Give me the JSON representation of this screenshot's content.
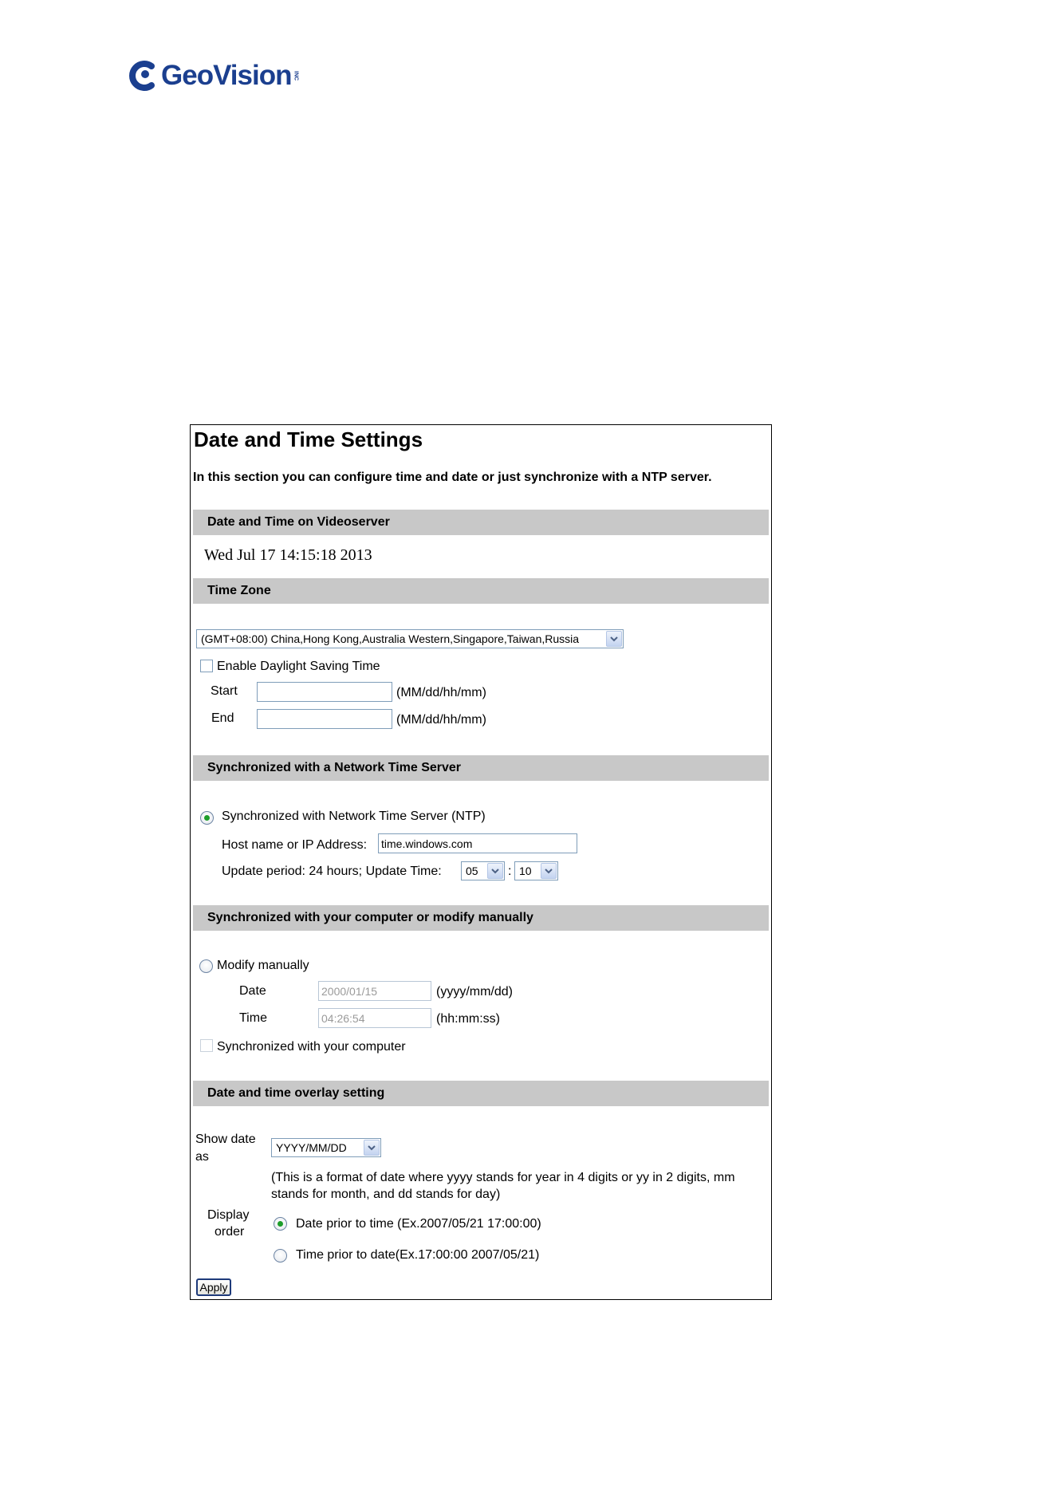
{
  "brand": {
    "name": "GeoVision",
    "inc": "INC"
  },
  "page": {
    "title": "Date and Time Settings",
    "intro": "In this section you can configure time and date or just synchronize with a NTP server."
  },
  "sections": {
    "current": "Date and Time on Videoserver",
    "timezone": "Time Zone",
    "ntp": "Synchronized with a Network Time Server",
    "manual": "Synchronized with your computer or modify manually",
    "overlay": "Date and time overlay setting"
  },
  "current_time": "Wed Jul 17 14:15:18 2013",
  "timezone": {
    "selected": "(GMT+08:00) China,Hong Kong,Australia Western,Singapore,Taiwan,Russia",
    "dst_label": "Enable Daylight Saving Time",
    "dst_checked": false,
    "start_label": "Start",
    "end_label": "End",
    "start_value": "",
    "end_value": "",
    "format_hint": "(MM/dd/hh/mm)"
  },
  "ntp": {
    "radio_label": "Synchronized with Network Time Server (NTP)",
    "selected": true,
    "host_label": "Host name or IP Address:",
    "host_value": "time.windows.com",
    "update_label": "Update period: 24 hours; Update Time:",
    "hour": "05",
    "separator": ":",
    "minute": "10"
  },
  "manual": {
    "radio_label": "Modify manually",
    "date_label": "Date",
    "date_value": "2000/01/15",
    "date_hint": "(yyyy/mm/dd)",
    "time_label": "Time",
    "time_value": "04:26:54",
    "time_hint": "(hh:mm:ss)",
    "sync_label": "Synchronized with your computer"
  },
  "overlay": {
    "show_date_label_1": "Show date",
    "show_date_label_2": "as",
    "date_format": "YYYY/MM/DD",
    "format_note_1": "(This is a format of date where yyyy stands for year in 4 digits or yy in 2 digits, mm",
    "format_note_2": "stands for month, and dd stands for day)",
    "display_order_label_1": "Display",
    "display_order_label_2": "order",
    "option_date_first": "Date prior to time (Ex.2007/05/21 17:00:00)",
    "option_time_first": "Time prior to date(Ex.17:00:00 2007/05/21)",
    "selected": "date_first"
  },
  "apply_label": "Apply",
  "colors": {
    "brand": "#1b3f8f",
    "section_bar": "#c8c8c8",
    "radio_selected": "#1d9d2a"
  }
}
